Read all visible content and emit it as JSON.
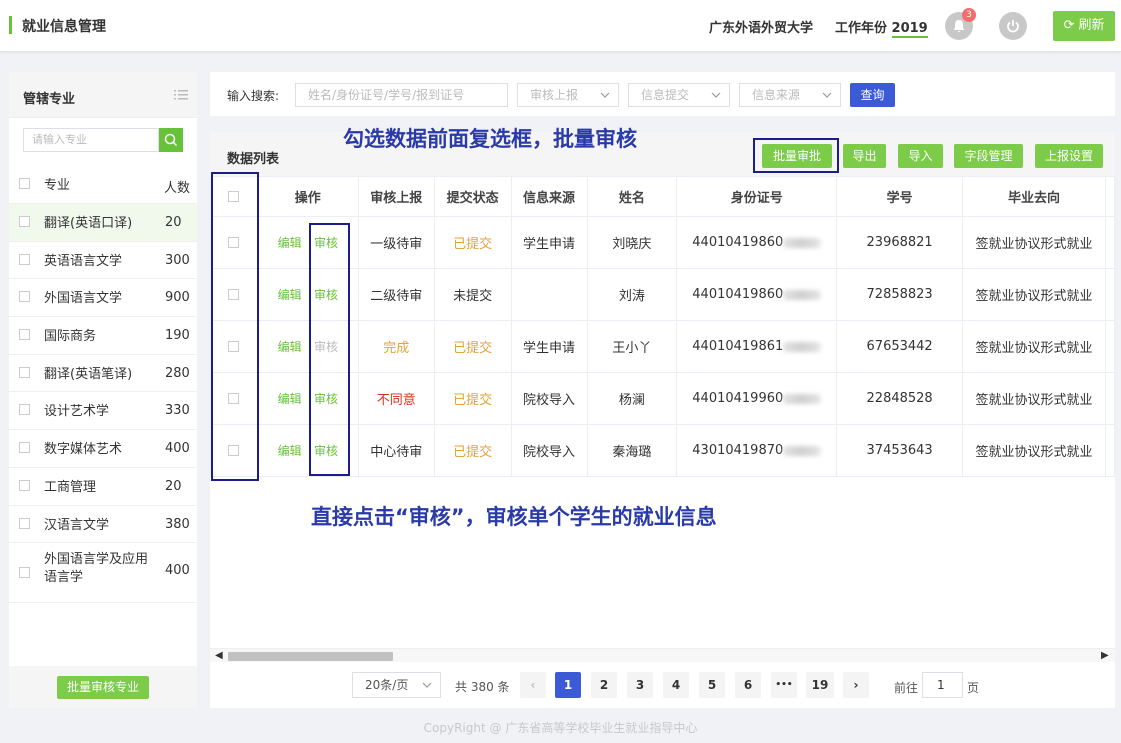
{
  "app": {
    "title": "就业信息管理",
    "school": "广东外语外贸大学",
    "year_label": "工作年份",
    "year": "2019",
    "notif_count": "3",
    "refresh": "刷新"
  },
  "sidebar": {
    "title": "管辖专业",
    "search_placeholder": "请输入专业",
    "col_major": "专业",
    "col_count": "人数",
    "items": [
      {
        "name": "翻译(英语口译)",
        "count": "20"
      },
      {
        "name": "英语语言文学",
        "count": "300"
      },
      {
        "name": "外国语言文学",
        "count": "900"
      },
      {
        "name": "国际商务",
        "count": "190"
      },
      {
        "name": "翻译(英语笔译)",
        "count": "280"
      },
      {
        "name": "设计艺术学",
        "count": "330"
      },
      {
        "name": "数字媒体艺术",
        "count": "400"
      },
      {
        "name": "工商管理",
        "count": "20"
      },
      {
        "name": "汉语言文学",
        "count": "380"
      },
      {
        "name": "外国语言学及应用语言学",
        "count": "400"
      }
    ],
    "batch_button": "批量审核专业"
  },
  "search": {
    "label": "输入搜索:",
    "keyword_placeholder": "姓名/身份证号/学号/报到证号",
    "audit_placeholder": "审核上报",
    "submit_placeholder": "信息提交",
    "source_placeholder": "信息来源",
    "query": "查询"
  },
  "list": {
    "title": "数据列表",
    "buttons": {
      "batch": "批量审批",
      "export": "导出",
      "import": "导入",
      "fields": "字段管理",
      "report": "上报设置"
    },
    "columns": [
      "操作",
      "审核上报",
      "提交状态",
      "信息来源",
      "姓名",
      "身份证号",
      "学号",
      "毕业去向"
    ],
    "edit": "编辑",
    "audit": "审核",
    "rows": [
      {
        "audit_status": "一级待审",
        "submit_status": "已提交",
        "source": "学生申请",
        "name": "刘晓庆",
        "id_prefix": "44010419860",
        "student_no": "23968821",
        "destination": "签就业协议形式就业"
      },
      {
        "audit_status": "二级待审",
        "submit_status": "未提交",
        "source": "",
        "name": "刘涛",
        "id_prefix": "44010419860",
        "student_no": "72858823",
        "destination": "签就业协议形式就业"
      },
      {
        "audit_status": "完成",
        "submit_status": "已提交",
        "source": "学生申请",
        "name": "王小丫",
        "id_prefix": "44010419861",
        "student_no": "67653442",
        "destination": "签就业协议形式就业"
      },
      {
        "audit_status": "不同意",
        "submit_status": "已提交",
        "source": "院校导入",
        "name": "杨澜",
        "id_prefix": "44010419960",
        "student_no": "22848528",
        "destination": "签就业协议形式就业"
      },
      {
        "audit_status": "中心待审",
        "submit_status": "已提交",
        "source": "院校导入",
        "name": "秦海璐",
        "id_prefix": "43010419870",
        "student_no": "37453643",
        "destination": "签就业协议形式就业"
      }
    ]
  },
  "pagination": {
    "page_size": "20条/页",
    "total": "共 380 条",
    "pages": [
      "1",
      "2",
      "3",
      "4",
      "5",
      "6",
      "•••",
      "19"
    ],
    "goto_label": "前往",
    "goto_value": "1",
    "goto_unit": "页"
  },
  "annotations": {
    "top": "勾选数据前面复选框，批量审核",
    "bottom": "直接点击“审核”，审核单个学生的就业信息"
  },
  "footer": "CopyRight @ 广东省高等学校毕业生就业指导中心",
  "colors": {
    "accent_green": "#7ccc4a",
    "primary_blue": "#3b5bd6",
    "annotation_navy": "#1c1c8a"
  }
}
